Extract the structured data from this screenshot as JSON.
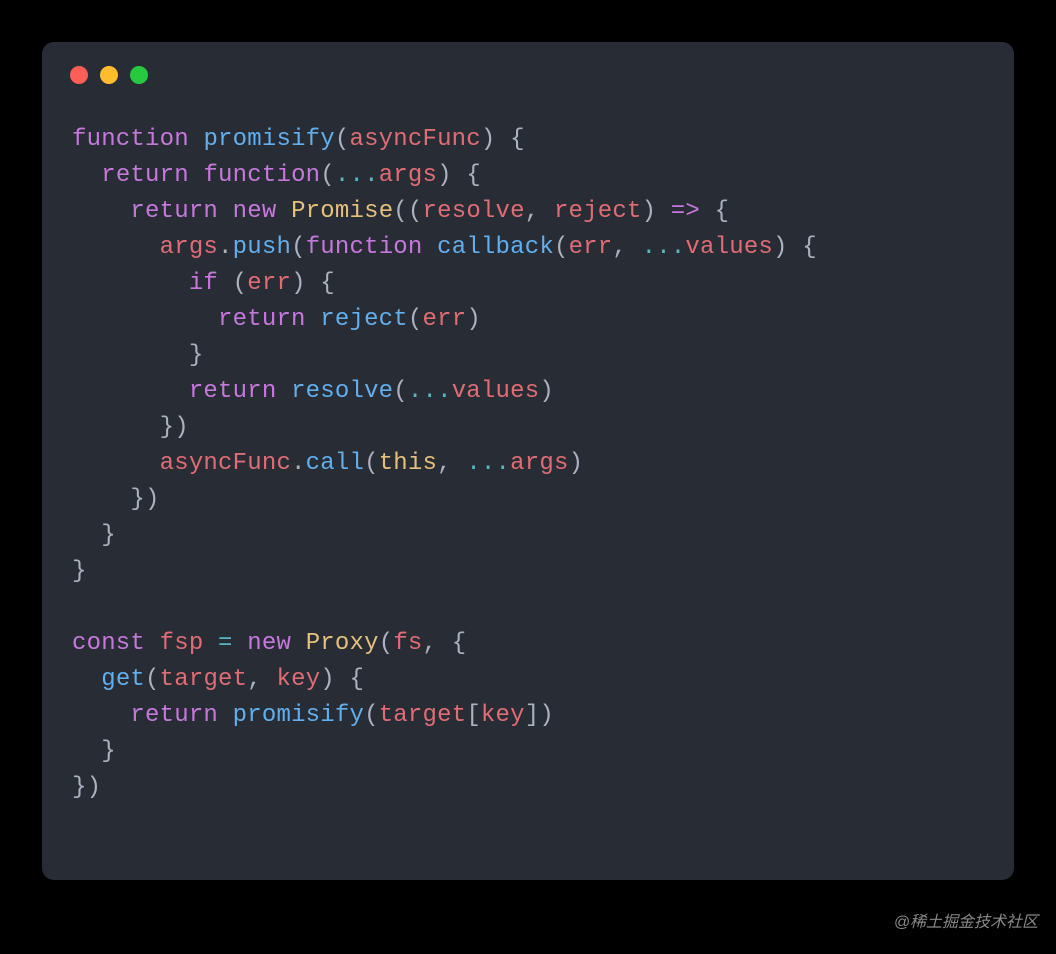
{
  "watermark": "@稀土掘金技术社区",
  "code": {
    "l1": {
      "kw1": "function",
      "fn": "promisify",
      "p": "(",
      "param": "asyncFunc",
      "p2": ") {"
    },
    "l2": {
      "ind": "  ",
      "kw": "return",
      "sp": " ",
      "kw2": "function",
      "p": "(",
      "op": "...",
      "param": "args",
      "p2": ") {"
    },
    "l3": {
      "ind": "    ",
      "kw": "return",
      "sp": " ",
      "kw2": "new",
      "sp2": " ",
      "cls": "Promise",
      "p": "((",
      "param1": "resolve",
      "c": ", ",
      "param2": "reject",
      "p2": ") ",
      "op": "=>",
      "p3": " {"
    },
    "l4": {
      "ind": "      ",
      "param": "args",
      "dot": ".",
      "fn": "push",
      "p": "(",
      "kw": "function",
      "sp": " ",
      "fn2": "callback",
      "p2": "(",
      "param2": "err",
      "c": ", ",
      "op": "...",
      "param3": "values",
      "p3": ") {"
    },
    "l5": {
      "ind": "        ",
      "kw": "if",
      "p": " (",
      "param": "err",
      "p2": ") {"
    },
    "l6": {
      "ind": "          ",
      "kw": "return",
      "sp": " ",
      "fn": "reject",
      "p": "(",
      "param": "err",
      "p2": ")"
    },
    "l7": {
      "ind": "        ",
      "p": "}"
    },
    "l8": {
      "ind": "        ",
      "kw": "return",
      "sp": " ",
      "fn": "resolve",
      "p": "(",
      "op": "...",
      "param": "values",
      "p2": ")"
    },
    "l9": {
      "ind": "      ",
      "p": "})"
    },
    "l10": {
      "ind": "      ",
      "param": "asyncFunc",
      "dot": ".",
      "fn": "call",
      "p": "(",
      "this": "this",
      "c": ", ",
      "op": "...",
      "param2": "args",
      "p2": ")"
    },
    "l11": {
      "ind": "    ",
      "p": "})"
    },
    "l12": {
      "ind": "  ",
      "p": "}"
    },
    "l13": {
      "p": "}"
    },
    "l14": {
      "blank": ""
    },
    "l15": {
      "kw": "const",
      "sp": " ",
      "param": "fsp",
      "sp2": " ",
      "op": "=",
      "sp3": " ",
      "kw2": "new",
      "sp4": " ",
      "cls": "Proxy",
      "p": "(",
      "param2": "fs",
      "c": ", {"
    },
    "l16": {
      "ind": "  ",
      "fn": "get",
      "p": "(",
      "param1": "target",
      "c": ", ",
      "param2": "key",
      "p2": ") {"
    },
    "l17": {
      "ind": "    ",
      "kw": "return",
      "sp": " ",
      "fn": "promisify",
      "p": "(",
      "param": "target",
      "b1": "[",
      "param2": "key",
      "b2": "])"
    },
    "l18": {
      "ind": "  ",
      "p": "}"
    },
    "l19": {
      "p": "})"
    }
  }
}
